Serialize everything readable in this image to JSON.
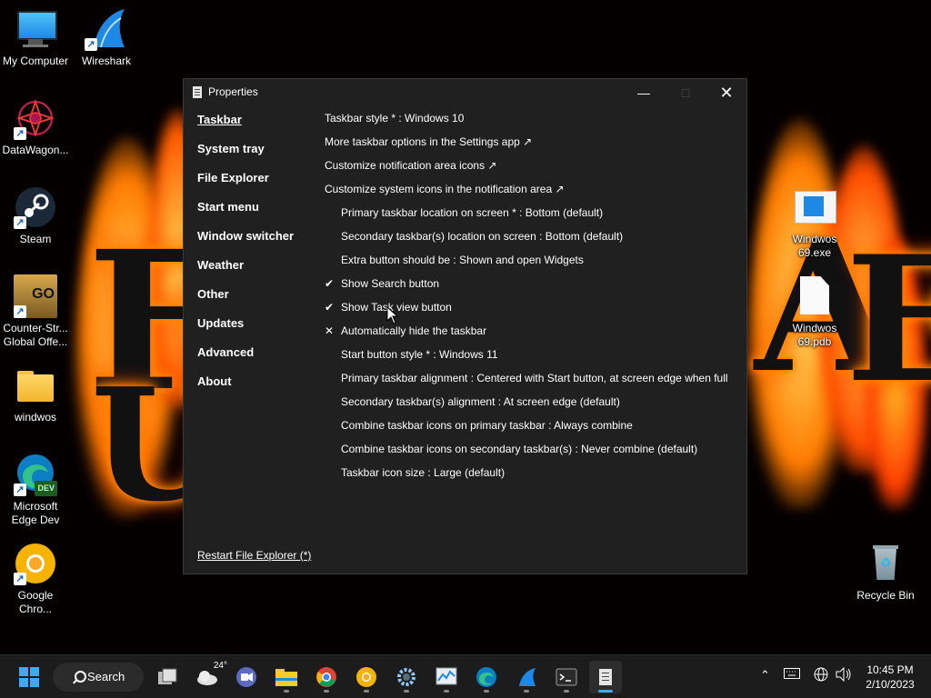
{
  "desktop": {
    "icons": [
      {
        "label": "My Computer"
      },
      {
        "label": "Wireshark"
      },
      {
        "label": "DataWagon..."
      },
      {
        "label": "Steam"
      },
      {
        "label": "Counter-Str... Global Offe..."
      },
      {
        "label": "windwos"
      },
      {
        "label": "Microsoft Edge Dev"
      },
      {
        "label": "Google Chro..."
      },
      {
        "label": "Windwos 69.exe"
      },
      {
        "label": "Windwos 69.pdb"
      },
      {
        "label": "Recycle Bin"
      }
    ],
    "icon_badges": {
      "csgo": "GO",
      "edge_dev": "DEV"
    }
  },
  "window": {
    "title": "Properties",
    "nav": [
      {
        "label": "Taskbar",
        "active": true
      },
      {
        "label": "System tray"
      },
      {
        "label": "File Explorer"
      },
      {
        "label": "Start menu"
      },
      {
        "label": "Window switcher"
      },
      {
        "label": "Weather"
      },
      {
        "label": "Other"
      },
      {
        "label": "Updates"
      },
      {
        "label": "Advanced"
      },
      {
        "label": "About"
      }
    ],
    "restart_label": "Restart File Explorer (*)",
    "settings": [
      {
        "text": "Taskbar style * : Windows 10",
        "indent": false,
        "mark": ""
      },
      {
        "text": "More taskbar options in the Settings app ↗",
        "indent": false,
        "mark": ""
      },
      {
        "text": "Customize notification area icons ↗",
        "indent": false,
        "mark": ""
      },
      {
        "text": "Customize system icons in the notification area ↗",
        "indent": false,
        "mark": ""
      },
      {
        "text": "Primary taskbar location on screen * : Bottom (default)",
        "indent": true,
        "mark": ""
      },
      {
        "text": "Secondary taskbar(s) location on screen : Bottom (default)",
        "indent": true,
        "mark": ""
      },
      {
        "text": "Extra button should be : Shown and open Widgets",
        "indent": true,
        "mark": ""
      },
      {
        "text": "Show Search button",
        "indent": true,
        "mark": "✔"
      },
      {
        "text": "Show Task view button",
        "indent": true,
        "mark": "✔"
      },
      {
        "text": "Automatically hide the taskbar",
        "indent": true,
        "mark": "✕"
      },
      {
        "text": "Start button style * : Windows 11",
        "indent": true,
        "mark": ""
      },
      {
        "text": "Primary taskbar alignment : Centered with Start button, at screen edge when full",
        "indent": true,
        "mark": ""
      },
      {
        "text": "Secondary taskbar(s) alignment : At screen edge (default)",
        "indent": true,
        "mark": ""
      },
      {
        "text": "Combine taskbar icons on primary taskbar : Always combine",
        "indent": true,
        "mark": ""
      },
      {
        "text": "Combine taskbar icons on secondary taskbar(s) : Never combine (default)",
        "indent": true,
        "mark": ""
      },
      {
        "text": "Taskbar icon size : Large (default)",
        "indent": true,
        "mark": ""
      }
    ]
  },
  "taskbar": {
    "search_label": "Search",
    "weather_temp": "24°",
    "time": "10:45 PM",
    "date": "2/10/2023",
    "colors": {
      "start": "#3fa9f5",
      "background": "#1c1c1c"
    }
  }
}
